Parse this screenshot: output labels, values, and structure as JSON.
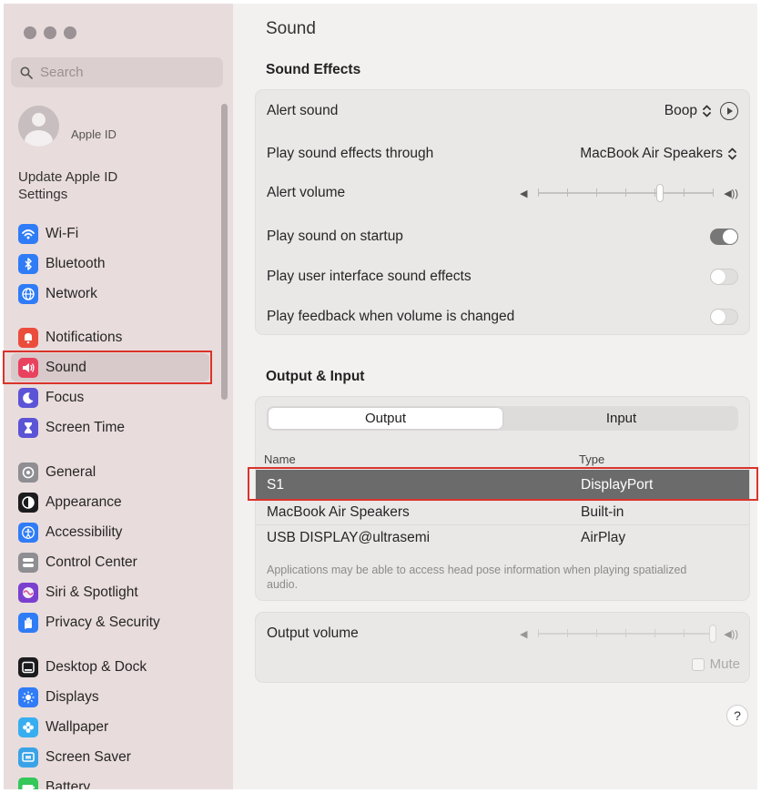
{
  "sidebar": {
    "search_placeholder": "Search",
    "apple_id_label": "Apple ID",
    "update_settings": "Update Apple ID Settings",
    "items": [
      {
        "label": "Wi-Fi",
        "icon": "wifi-icon",
        "color": "#2f7cf6"
      },
      {
        "label": "Bluetooth",
        "icon": "bluetooth-icon",
        "color": "#2f7cf6"
      },
      {
        "label": "Network",
        "icon": "globe-icon",
        "color": "#2f7cf6"
      },
      {
        "label": "Notifications",
        "icon": "bell-icon",
        "color": "#eb4d3d"
      },
      {
        "label": "Sound",
        "icon": "speaker-icon",
        "color": "#e9425f",
        "selected": true
      },
      {
        "label": "Focus",
        "icon": "moon-icon",
        "color": "#5b54d6"
      },
      {
        "label": "Screen Time",
        "icon": "hourglass-icon",
        "color": "#5b54d6"
      },
      {
        "label": "General",
        "icon": "gear-icon",
        "color": "#8e8e93"
      },
      {
        "label": "Appearance",
        "icon": "appearance-icon",
        "color": "#1c1c1e"
      },
      {
        "label": "Accessibility",
        "icon": "accessibility-icon",
        "color": "#2f7cf6"
      },
      {
        "label": "Control Center",
        "icon": "control-center-icon",
        "color": "#8e8e93"
      },
      {
        "label": "Siri & Spotlight",
        "icon": "siri-icon",
        "color": "#7b3fd0"
      },
      {
        "label": "Privacy & Security",
        "icon": "hand-icon",
        "color": "#2f7cf6"
      },
      {
        "label": "Desktop & Dock",
        "icon": "dock-icon",
        "color": "#1c1c1e"
      },
      {
        "label": "Displays",
        "icon": "sun-icon",
        "color": "#2f7cf6"
      },
      {
        "label": "Wallpaper",
        "icon": "flower-icon",
        "color": "#37aef0"
      },
      {
        "label": "Screen Saver",
        "icon": "screensaver-icon",
        "color": "#3aa3e8"
      },
      {
        "label": "Battery",
        "icon": "battery-icon",
        "color": "#34c759"
      }
    ]
  },
  "main": {
    "title": "Sound",
    "sound_effects": {
      "heading": "Sound Effects",
      "alert_sound_label": "Alert sound",
      "alert_sound_value": "Boop",
      "play_through_label": "Play sound effects through",
      "play_through_value": "MacBook Air Speakers",
      "alert_volume_label": "Alert volume",
      "alert_volume_level": 0.7,
      "startup_label": "Play sound on startup",
      "startup_on": true,
      "ui_sounds_label": "Play user interface sound effects",
      "ui_sounds_on": false,
      "feedback_label": "Play feedback when volume is changed",
      "feedback_on": false
    },
    "output_input": {
      "heading": "Output & Input",
      "tab_output": "Output",
      "tab_input": "Input",
      "col_name": "Name",
      "col_type": "Type",
      "devices": [
        {
          "name": "S1",
          "type": "DisplayPort",
          "selected": true
        },
        {
          "name": "MacBook Air Speakers",
          "type": "Built-in"
        },
        {
          "name": "USB DISPLAY@ultrasemi",
          "type": "AirPlay"
        }
      ],
      "note": "Applications may be able to access head pose information when playing spatialized audio."
    },
    "output_volume": {
      "label": "Output volume",
      "level": 1.0,
      "mute_label": "Mute"
    },
    "help": "?"
  }
}
